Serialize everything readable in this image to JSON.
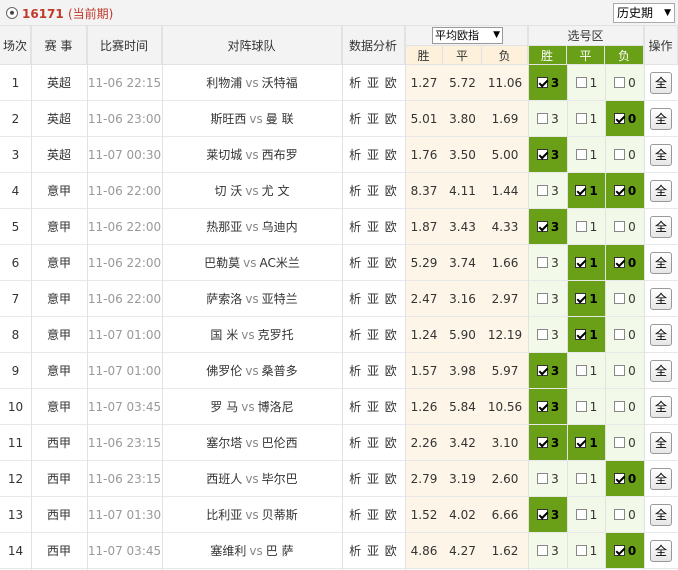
{
  "header": {
    "issue_no": "16171",
    "issue_status": "(当前期)",
    "history_select": "历史期",
    "columns": {
      "no": "场次",
      "league": "赛 事",
      "time": "比赛时间",
      "match": "对阵球队",
      "analysis": "数据分析",
      "odds_select": "平均欧指",
      "odds_win": "胜",
      "odds_draw": "平",
      "odds_lose": "负",
      "pick_area": "选号区",
      "pick_win": "胜",
      "pick_draw": "平",
      "pick_lose": "负",
      "operation": "操作"
    }
  },
  "analysis_links": "析 亚 欧",
  "all_button": "全",
  "vs_text": "vs",
  "rows": [
    {
      "no": "1",
      "league": "英超",
      "time": "11-06 22:15",
      "home": "利物浦",
      "away": "沃特福",
      "odds": [
        "1.27",
        "5.72",
        "11.06"
      ],
      "picks": [
        {
          "label": "3",
          "checked": true
        },
        {
          "label": "1",
          "checked": false
        },
        {
          "label": "0",
          "checked": false
        }
      ]
    },
    {
      "no": "2",
      "league": "英超",
      "time": "11-06 23:00",
      "home": "斯旺西",
      "away": "曼 联",
      "odds": [
        "5.01",
        "3.80",
        "1.69"
      ],
      "picks": [
        {
          "label": "3",
          "checked": false
        },
        {
          "label": "1",
          "checked": false
        },
        {
          "label": "0",
          "checked": true
        }
      ]
    },
    {
      "no": "3",
      "league": "英超",
      "time": "11-07 00:30",
      "home": "莱切城",
      "away": "西布罗",
      "odds": [
        "1.76",
        "3.50",
        "5.00"
      ],
      "picks": [
        {
          "label": "3",
          "checked": true
        },
        {
          "label": "1",
          "checked": false
        },
        {
          "label": "0",
          "checked": false
        }
      ]
    },
    {
      "no": "4",
      "league": "意甲",
      "time": "11-06 22:00",
      "home": "切 沃",
      "away": "尤 文",
      "odds": [
        "8.37",
        "4.11",
        "1.44"
      ],
      "picks": [
        {
          "label": "3",
          "checked": false
        },
        {
          "label": "1",
          "checked": true
        },
        {
          "label": "0",
          "checked": true
        }
      ]
    },
    {
      "no": "5",
      "league": "意甲",
      "time": "11-06 22:00",
      "home": "热那亚",
      "away": "乌迪内",
      "odds": [
        "1.87",
        "3.43",
        "4.33"
      ],
      "picks": [
        {
          "label": "3",
          "checked": true
        },
        {
          "label": "1",
          "checked": false
        },
        {
          "label": "0",
          "checked": false
        }
      ]
    },
    {
      "no": "6",
      "league": "意甲",
      "time": "11-06 22:00",
      "home": "巴勒莫",
      "away": "AC米兰",
      "odds": [
        "5.29",
        "3.74",
        "1.66"
      ],
      "picks": [
        {
          "label": "3",
          "checked": false
        },
        {
          "label": "1",
          "checked": true
        },
        {
          "label": "0",
          "checked": true
        }
      ]
    },
    {
      "no": "7",
      "league": "意甲",
      "time": "11-06 22:00",
      "home": "萨索洛",
      "away": "亚特兰",
      "odds": [
        "2.47",
        "3.16",
        "2.97"
      ],
      "picks": [
        {
          "label": "3",
          "checked": false
        },
        {
          "label": "1",
          "checked": true
        },
        {
          "label": "0",
          "checked": false
        }
      ]
    },
    {
      "no": "8",
      "league": "意甲",
      "time": "11-07 01:00",
      "home": "国 米",
      "away": "克罗托",
      "odds": [
        "1.24",
        "5.90",
        "12.19"
      ],
      "picks": [
        {
          "label": "3",
          "checked": false
        },
        {
          "label": "1",
          "checked": true
        },
        {
          "label": "0",
          "checked": false
        }
      ]
    },
    {
      "no": "9",
      "league": "意甲",
      "time": "11-07 01:00",
      "home": "佛罗伦",
      "away": "桑普多",
      "odds": [
        "1.57",
        "3.98",
        "5.97"
      ],
      "picks": [
        {
          "label": "3",
          "checked": true
        },
        {
          "label": "1",
          "checked": false
        },
        {
          "label": "0",
          "checked": false
        }
      ]
    },
    {
      "no": "10",
      "league": "意甲",
      "time": "11-07 03:45",
      "home": "罗 马",
      "away": "博洛尼",
      "odds": [
        "1.26",
        "5.84",
        "10.56"
      ],
      "picks": [
        {
          "label": "3",
          "checked": true
        },
        {
          "label": "1",
          "checked": false
        },
        {
          "label": "0",
          "checked": false
        }
      ]
    },
    {
      "no": "11",
      "league": "西甲",
      "time": "11-06 23:15",
      "home": "塞尔塔",
      "away": "巴伦西",
      "odds": [
        "2.26",
        "3.42",
        "3.10"
      ],
      "picks": [
        {
          "label": "3",
          "checked": true
        },
        {
          "label": "1",
          "checked": true
        },
        {
          "label": "0",
          "checked": false
        }
      ]
    },
    {
      "no": "12",
      "league": "西甲",
      "time": "11-06 23:15",
      "home": "西班人",
      "away": "毕尔巴",
      "odds": [
        "2.79",
        "3.19",
        "2.60"
      ],
      "picks": [
        {
          "label": "3",
          "checked": false
        },
        {
          "label": "1",
          "checked": false
        },
        {
          "label": "0",
          "checked": true
        }
      ]
    },
    {
      "no": "13",
      "league": "西甲",
      "time": "11-07 01:30",
      "home": "比利亚",
      "away": "贝蒂斯",
      "odds": [
        "1.52",
        "4.02",
        "6.66"
      ],
      "picks": [
        {
          "label": "3",
          "checked": true
        },
        {
          "label": "1",
          "checked": false
        },
        {
          "label": "0",
          "checked": false
        }
      ]
    },
    {
      "no": "14",
      "league": "西甲",
      "time": "11-07 03:45",
      "home": "塞维利",
      "away": "巴 萨",
      "odds": [
        "4.86",
        "4.27",
        "1.62"
      ],
      "picks": [
        {
          "label": "3",
          "checked": false
        },
        {
          "label": "1",
          "checked": false
        },
        {
          "label": "0",
          "checked": true
        }
      ]
    }
  ]
}
